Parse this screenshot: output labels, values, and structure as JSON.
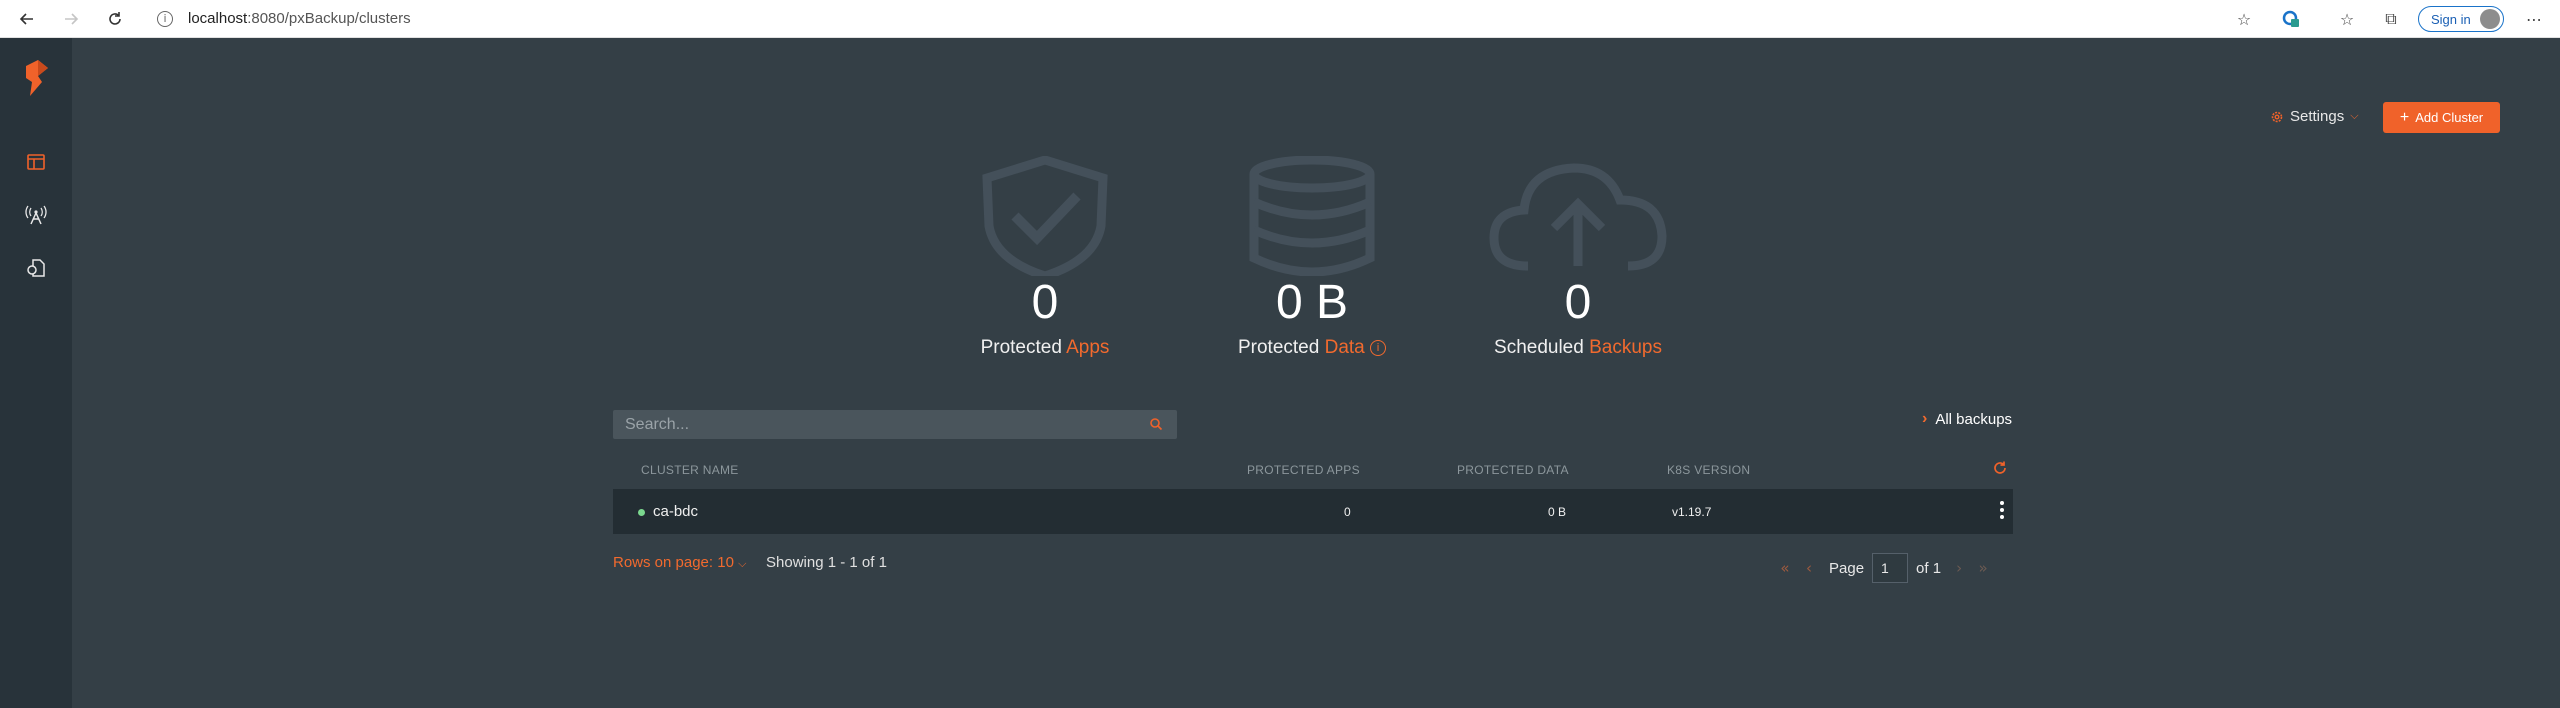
{
  "browser": {
    "url_host": "localhost",
    "url_path": ":8080/pxBackup/clusters",
    "signin_label": "Sign in"
  },
  "header": {
    "settings_label": "Settings",
    "add_cluster_label": "Add Cluster"
  },
  "stats": [
    {
      "value": "0",
      "label_prefix": "Protected",
      "label_accent": "Apps",
      "icon": "shield-check-icon"
    },
    {
      "value": "0 B",
      "label_prefix": "Protected",
      "label_accent": "Data",
      "icon": "database-icon"
    },
    {
      "value": "0",
      "label_prefix": "Scheduled",
      "label_accent": "Backups",
      "icon": "cloud-upload-icon"
    }
  ],
  "search": {
    "placeholder": "Search..."
  },
  "all_backups_label": "All backups",
  "table": {
    "headers": [
      "CLUSTER NAME",
      "PROTECTED APPS",
      "PROTECTED DATA",
      "K8S VERSION"
    ],
    "rows": [
      {
        "name": "ca-bdc",
        "protected_apps": "0",
        "protected_data": "0 B",
        "k8s_version": "v1.19.7",
        "status_color": "#7bd88f"
      }
    ]
  },
  "footer": {
    "rows_on_page_label": "Rows on page: 10",
    "showing_label": "Showing 1 - 1 of 1",
    "page_label": "Page",
    "page_value": "1",
    "of_label": "of 1"
  },
  "colors": {
    "accent": "#f0622a",
    "background": "#343f46",
    "sidebar": "#28333a",
    "row_bg": "#232d33"
  }
}
